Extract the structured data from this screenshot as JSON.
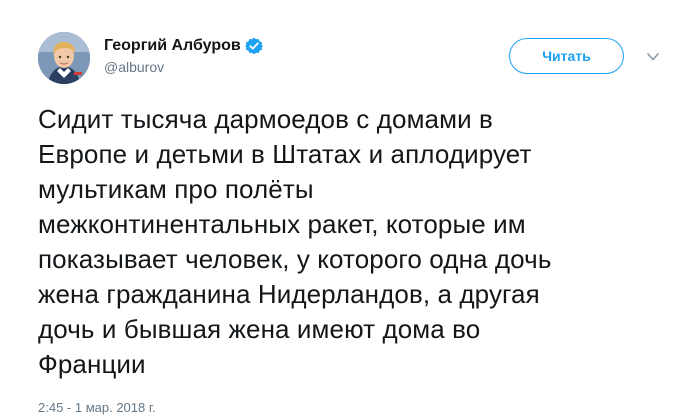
{
  "author": {
    "display_name": "Георгий Албуров",
    "handle": "@alburov",
    "verified": true
  },
  "follow_button_label": "Читать",
  "tweet": {
    "lines": [
      "Сидит тысяча дармоедов с домами в",
      "Европе и детьми в Штатах и аплодирует",
      "мультикам про полёты",
      "межконтинентальных ракет, которые им",
      "показывает человек, у которого одна дочь",
      "жена гражданина Нидерландов, а другая",
      "дочь и бывшая жена имеют дома во",
      "Франции"
    ]
  },
  "timestamp": "2:45 - 1 мар. 2018 г.",
  "colors": {
    "accent": "#1da1f2",
    "text": "#14171a",
    "secondary": "#657786"
  },
  "icons": {
    "verified": "verified-badge-icon",
    "menu": "chevron-down-icon"
  }
}
